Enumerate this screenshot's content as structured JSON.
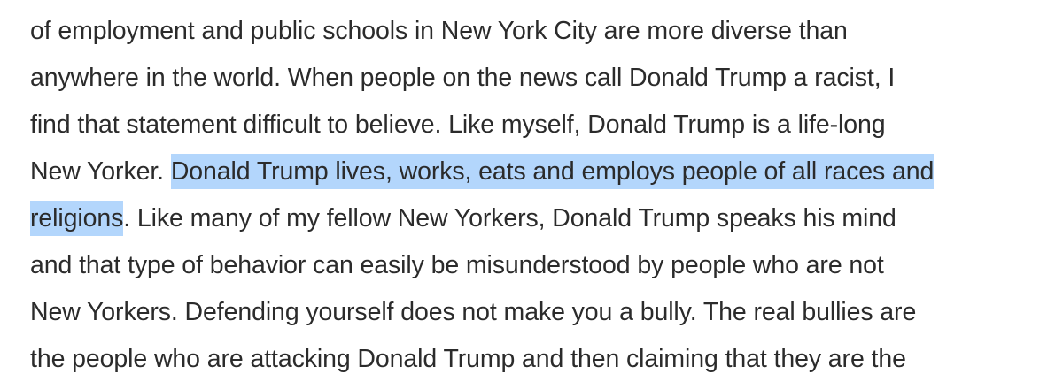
{
  "article": {
    "lines": [
      "of employment and public schools in New York City are more diverse than",
      "anywhere in the world. When people on the news call Donald Trump a racist, I",
      "find that statement difficult to believe. Like myself, Donald Trump is a life-long"
    ],
    "line4": {
      "before": "New Yorker. ",
      "selected": "Donald Trump lives, works, eats and employs people of all races and"
    },
    "line5": {
      "selected": "religions",
      "after": ". Like many of my fellow New Yorkers, Donald Trump speaks his mind"
    },
    "lines_after": [
      "and that type of behavior can easily be misunderstood by people who are not",
      "New Yorkers. Defending yourself does not make you a bully. The real bullies are",
      "the people who are attacking Donald Trump and then claiming that they are the"
    ]
  },
  "colors": {
    "text": "#2b2b2b",
    "selection": "#b3d6fc"
  }
}
